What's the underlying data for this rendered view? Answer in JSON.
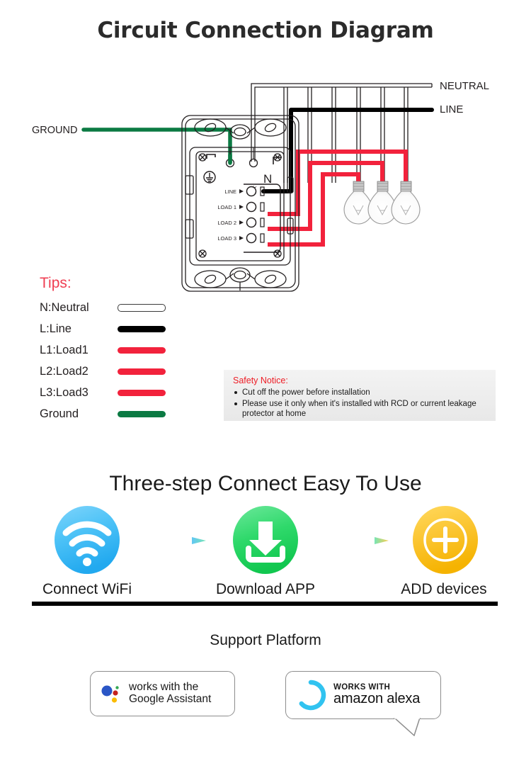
{
  "title": "Circuit Connection Diagram",
  "diagram": {
    "labels": {
      "ground": "GROUND",
      "neutral": "NEUTRAL",
      "line": "LINE",
      "terminal_n": "N",
      "terminal_line": "LINE",
      "terminal_load1": "LOAD 1",
      "terminal_load2": "LOAD 2",
      "terminal_load3": "LOAD 3"
    },
    "bulb_count": 3,
    "wire_colors": {
      "neutral": "#ffffff",
      "line": "#000000",
      "load": "#f2223c",
      "ground": "#0b7a43",
      "outline": "#231f20"
    }
  },
  "tips": {
    "heading": "Tips:",
    "heading_color": "#ef3e52",
    "items": [
      {
        "label": "N:Neutral",
        "swatch": "neutral",
        "color": "#ffffff"
      },
      {
        "label": "L:Line",
        "swatch": "line",
        "color": "#000000"
      },
      {
        "label": "L1:Load1",
        "swatch": "load",
        "color": "#f2223c"
      },
      {
        "label": "L2:Load2",
        "swatch": "load",
        "color": "#f2223c"
      },
      {
        "label": "L3:Load3",
        "swatch": "load",
        "color": "#f2223c"
      },
      {
        "label": "Ground",
        "swatch": "ground",
        "color": "#0b7a43"
      }
    ]
  },
  "safety": {
    "title": "Safety Notice:",
    "title_color": "#ee1c25",
    "items": [
      "Cut off the power before installation",
      "Please use it only when it's installed with RCD or current leakage protector at home"
    ]
  },
  "steps_section": {
    "heading": "Three-step Connect Easy To Use",
    "steps": [
      {
        "icon": "wifi-icon",
        "label": "Connect WiFi",
        "color": "#4ec3f7"
      },
      {
        "icon": "download-icon",
        "label": "Download APP",
        "color": "#2fd96b"
      },
      {
        "icon": "plus-circle-icon",
        "label": "ADD devices",
        "color": "#fbc531"
      }
    ]
  },
  "support": {
    "title": "Support Platform",
    "badges": [
      {
        "logo": "google-assistant-logo",
        "line1": "works with the",
        "line2": "Google Assistant"
      },
      {
        "logo": "amazon-alexa-logo",
        "line1": "WORKS WITH",
        "line2": "amazon alexa"
      }
    ]
  }
}
